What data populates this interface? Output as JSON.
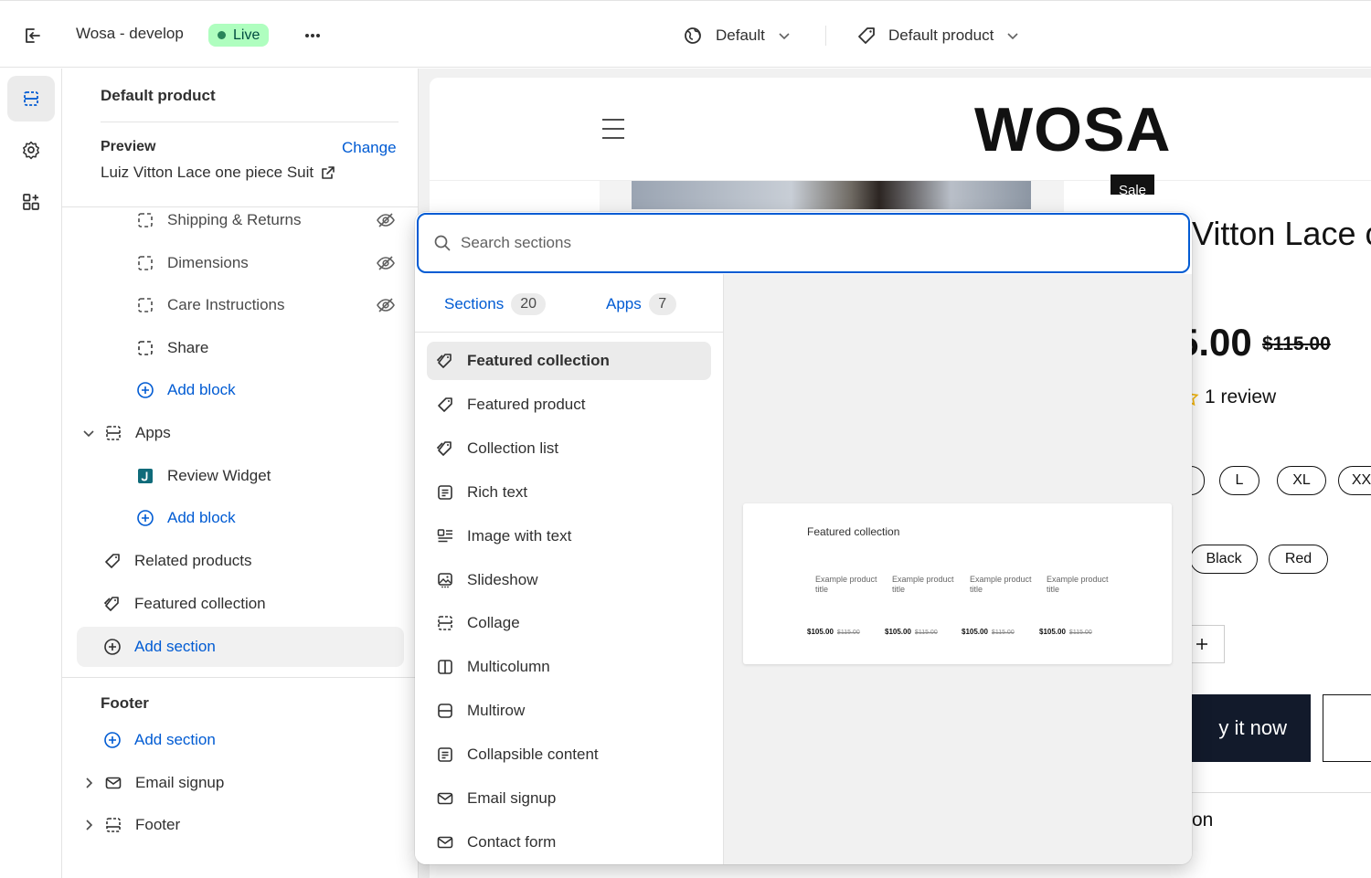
{
  "topbar": {
    "store_name": "Wosa - develop",
    "live_label": "Live",
    "theme_select": "Default",
    "template_select": "Default product"
  },
  "sidebar": {
    "title": "Default product",
    "preview_label": "Preview",
    "change_label": "Change",
    "preview_product": "Luiz Vitton Lace one piece Suit",
    "blocks": [
      {
        "label": "Shipping & Returns",
        "icon": "block-dashed-icon",
        "hidden": true
      },
      {
        "label": "Dimensions",
        "icon": "block-dashed-icon",
        "hidden": true
      },
      {
        "label": "Care Instructions",
        "icon": "block-dashed-icon",
        "hidden": true
      },
      {
        "label": "Share",
        "icon": "block-dashed-icon",
        "hidden": false
      }
    ],
    "add_block_1": "Add block",
    "apps_section": "Apps",
    "review_widget": "Review Widget",
    "add_block_2": "Add block",
    "related_products": "Related products",
    "featured_collection": "Featured collection",
    "add_section": "Add section",
    "footer_label": "Footer",
    "footer_add_section": "Add section",
    "email_signup": "Email signup",
    "footer_item": "Footer"
  },
  "storefront": {
    "logo": "WOSA",
    "sale_badge": "Sale",
    "title_fragment": "Vitton Lace o",
    "price_fragment": "5.00",
    "compare_price": "$115.00",
    "review_text": "1 review",
    "sizes": [
      "",
      "L",
      "XL",
      "XXL"
    ],
    "colors": [
      "Black",
      "Red"
    ],
    "buy_fragment": "y it now",
    "desc_fragment": "on"
  },
  "picker": {
    "search_placeholder": "Search sections",
    "tab_sections": "Sections",
    "tab_sections_count": "20",
    "tab_apps": "Apps",
    "tab_apps_count": "7",
    "items": [
      {
        "label": "Featured collection",
        "icon": "collection-tag-icon",
        "selected": true
      },
      {
        "label": "Featured product",
        "icon": "tag-icon",
        "selected": false
      },
      {
        "label": "Collection list",
        "icon": "collection-tag-icon",
        "selected": false
      },
      {
        "label": "Rich text",
        "icon": "text-block-icon",
        "selected": false
      },
      {
        "label": "Image with text",
        "icon": "image-text-icon",
        "selected": false
      },
      {
        "label": "Slideshow",
        "icon": "slideshow-icon",
        "selected": false
      },
      {
        "label": "Collage",
        "icon": "collage-icon",
        "selected": false
      },
      {
        "label": "Multicolumn",
        "icon": "multicolumn-icon",
        "selected": false
      },
      {
        "label": "Multirow",
        "icon": "multirow-icon",
        "selected": false
      },
      {
        "label": "Collapsible content",
        "icon": "text-block-icon",
        "selected": false
      },
      {
        "label": "Email signup",
        "icon": "envelope-icon",
        "selected": false
      },
      {
        "label": "Contact form",
        "icon": "envelope-icon",
        "selected": false
      }
    ],
    "preview": {
      "title": "Featured collection",
      "product_title": "Example product title",
      "price": "$105.00",
      "compare_price": "$115.00"
    }
  },
  "colors": {
    "accent": "#005bd3",
    "live_bg": "#affebf",
    "live_dot": "#29845a",
    "selected_bg": "#ebebeb",
    "canvas_bg": "#f1f1f1"
  }
}
